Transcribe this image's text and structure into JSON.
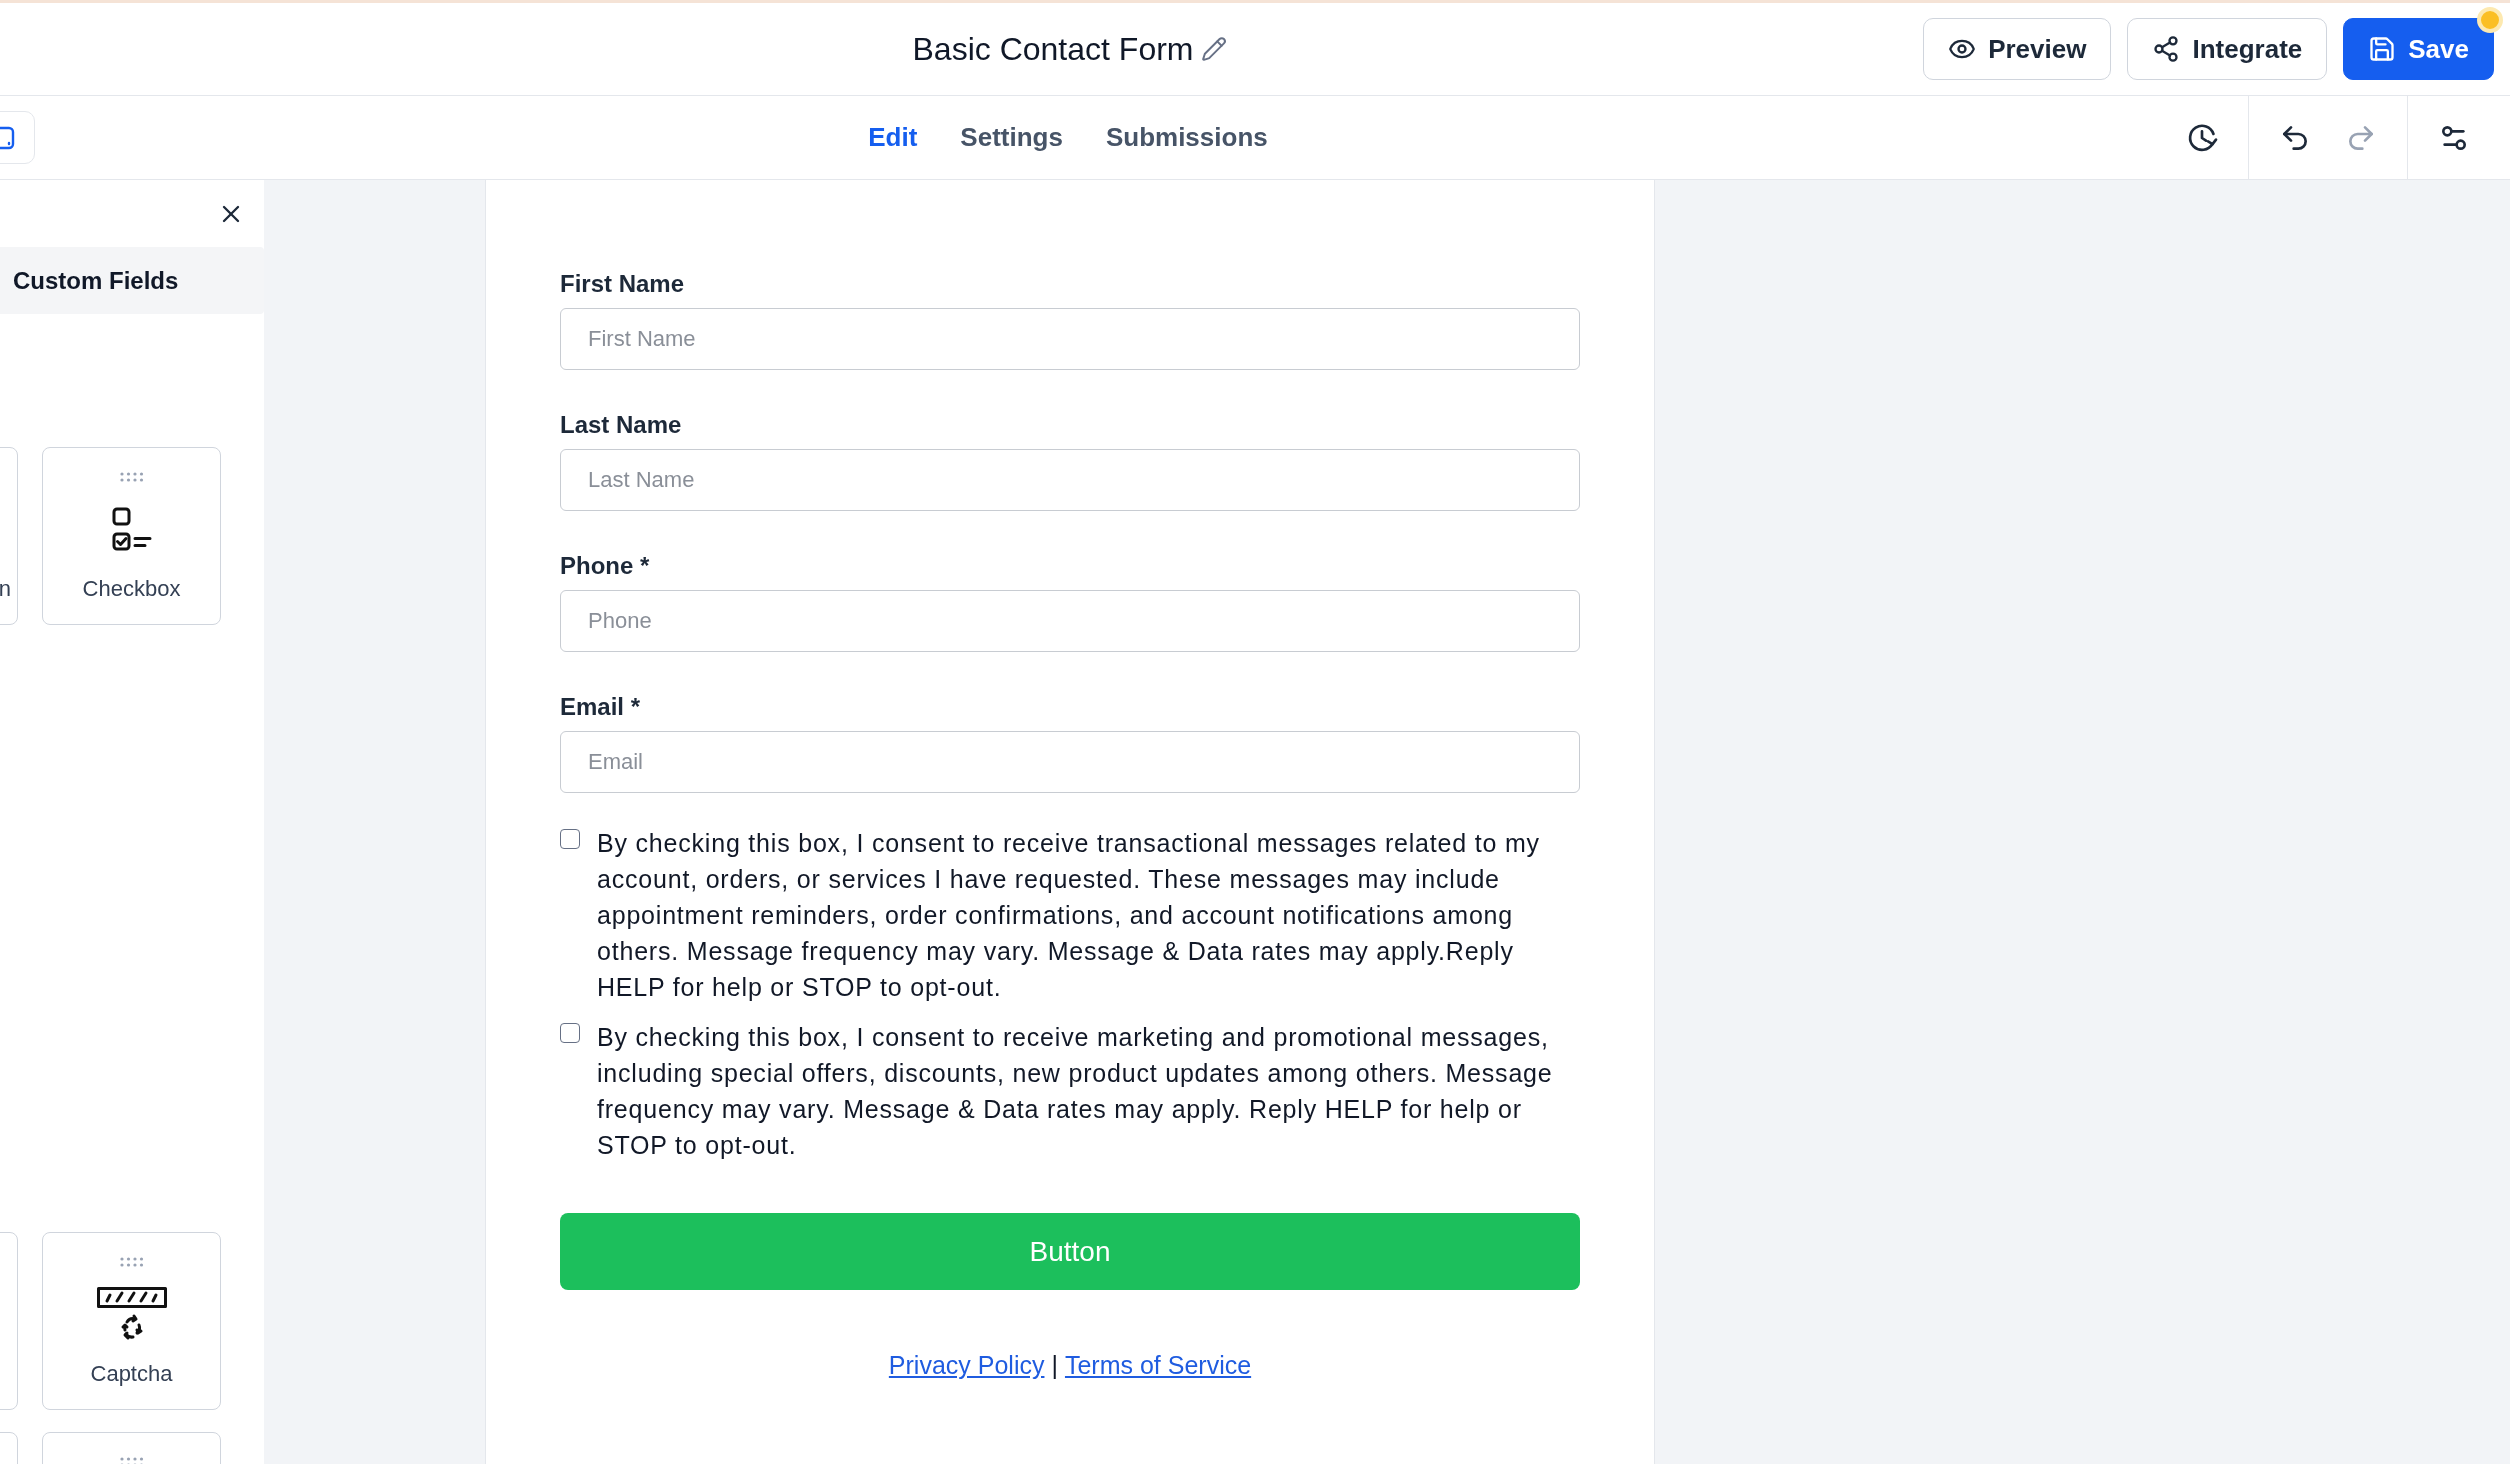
{
  "header": {
    "title": "Basic Contact Form",
    "actions": [
      {
        "label": "Preview",
        "kind": "preview",
        "primary": false
      },
      {
        "label": "Integrate",
        "kind": "integrate",
        "primary": false
      },
      {
        "label": "Save",
        "kind": "save",
        "primary": true,
        "unsaved": true
      }
    ]
  },
  "tabs": [
    {
      "label": "Edit",
      "selected": true
    },
    {
      "label": "Settings",
      "selected": false
    },
    {
      "label": "Submissions",
      "selected": false
    }
  ],
  "toolbar": [
    {
      "items": [
        {
          "kind": "history",
          "disabled": false
        }
      ]
    },
    {
      "items": [
        {
          "kind": "undo",
          "disabled": false
        },
        {
          "kind": "redo",
          "disabled": true
        }
      ]
    },
    {
      "items": [
        {
          "kind": "settings",
          "disabled": false
        }
      ]
    }
  ],
  "sidebar": {
    "section": "Custom Fields",
    "groups": [
      {
        "fields": [
          {
            "label": "n",
            "kind": "other"
          },
          {
            "label": "Checkbox",
            "kind": "checkbox"
          }
        ]
      },
      {
        "fields": [
          {
            "kind": "other"
          },
          {
            "label": "Captcha",
            "kind": "captcha"
          },
          {
            "kind": "other"
          },
          {
            "kind": "other"
          }
        ]
      }
    ]
  },
  "form": {
    "fields": [
      {
        "label": "First Name",
        "placeholder": "First Name"
      },
      {
        "label": "Last Name",
        "placeholder": "Last Name"
      },
      {
        "label": "Phone *",
        "placeholder": "Phone"
      },
      {
        "label": "Email *",
        "placeholder": "Email"
      }
    ],
    "consents": [
      {
        "text": "By checking this box, I consent to receive transactional messages related to my account, orders, or services I have requested. These messages may include appointment reminders, order confirmations, and account notifications among others. Message frequency may vary. Message & Data rates may apply.Reply HELP for help or STOP to opt-out.",
        "checked": false
      },
      {
        "text": "By checking this box, I consent to receive marketing and promotional messages, including special offers, discounts, new product updates among others. Message frequency may vary. Message & Data rates may apply. Reply HELP for help or STOP to opt-out.",
        "checked": false
      }
    ],
    "submit": "Button",
    "links": [
      {
        "label": "Privacy Policy"
      },
      {
        "label": "Terms of Service"
      }
    ],
    "link_separator": "|"
  }
}
